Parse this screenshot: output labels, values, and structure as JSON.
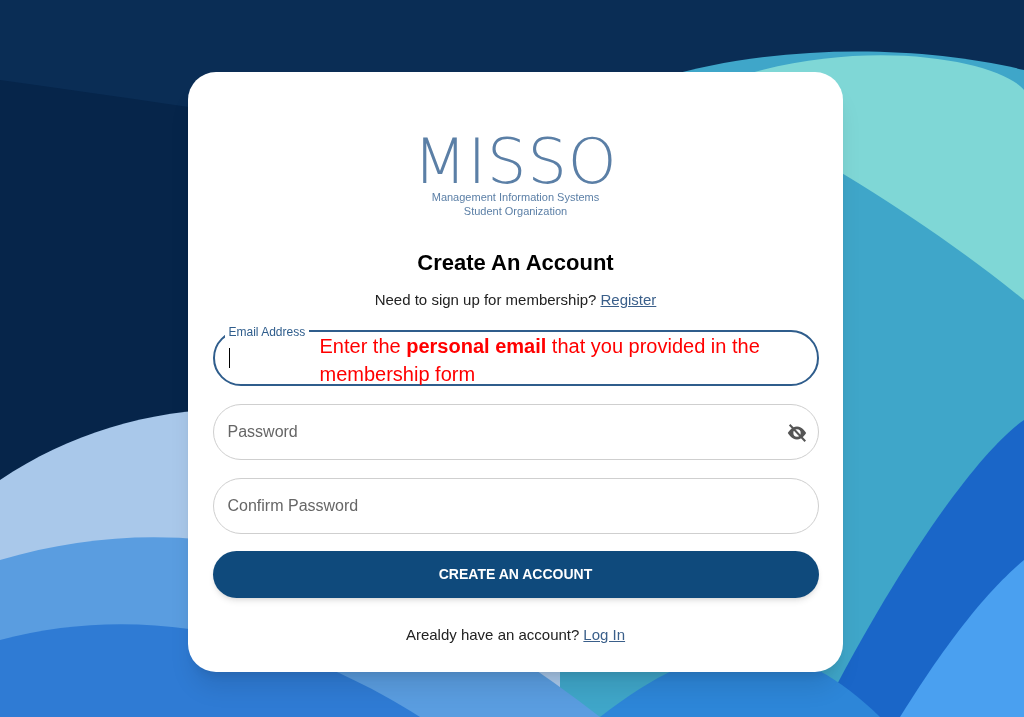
{
  "logo": {
    "title": "MISSO",
    "line_1": "Management Information Systems",
    "line_2": "Student Organization"
  },
  "heading": "Create An Account",
  "signup_prompt": {
    "text": "Need to sign up for membership?",
    "link": "Register"
  },
  "fields": [
    {
      "label": "Email Address",
      "focused": true,
      "annotation": "Enter the **personal email** that you provided in the membership form"
    },
    {
      "placeholder": "Password",
      "focused": false,
      "reveal_icon": true
    },
    {
      "placeholder": "Confirm Password",
      "focused": false
    }
  ],
  "submit_button": "CREATE AN ACCOUNT",
  "login_prompt": {
    "text": "Arealdy have an account?",
    "link": "Log In"
  }
}
